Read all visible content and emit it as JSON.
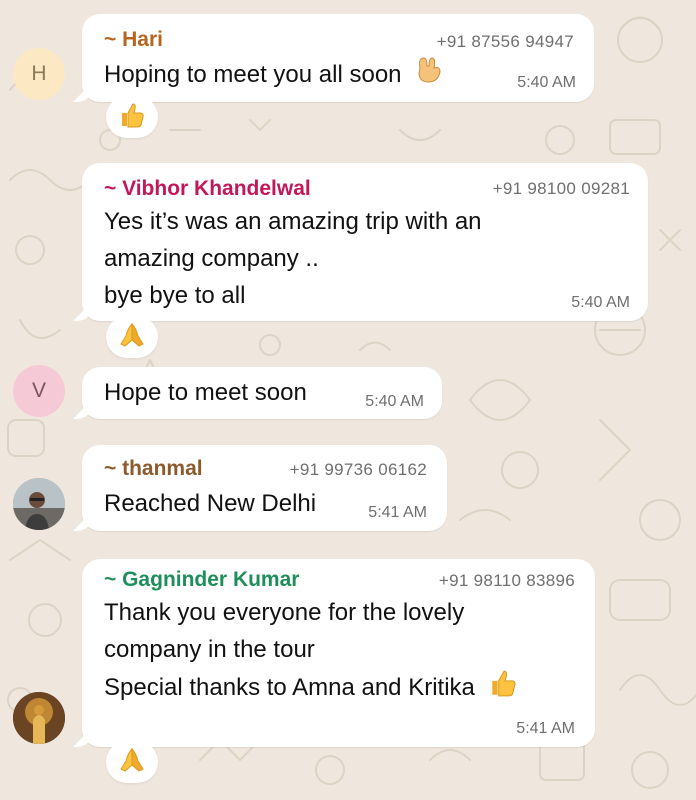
{
  "messages": [
    {
      "avatar_letter": "H",
      "sender": "~ Hari",
      "phone": "+91 87556 94947",
      "lines": [
        "Hoping to meet you all soon"
      ],
      "inline_emoji": "rock-hand-emoji",
      "time": "5:40 AM",
      "reaction": "thumbs-up-emoji",
      "sender_color": "#b5651d"
    },
    {
      "sender": "~ Vibhor Khandelwal",
      "phone": "+91 98100 09281",
      "lines": [
        "Yes it’s was an amazing trip with an",
        "amazing company ..",
        "bye bye to all"
      ],
      "time": "5:40 AM",
      "reaction": "folded-hands-emoji",
      "sender_color": "#c2185b"
    },
    {
      "avatar_letter": "V",
      "lines": [
        "Hope to meet soon"
      ],
      "time": "5:40 AM"
    },
    {
      "sender": "~ thanmal",
      "phone": "+91 99736 06162",
      "lines": [
        "Reached New Delhi"
      ],
      "time": "5:41 AM",
      "sender_color": "#8d5a2b"
    },
    {
      "sender": "~ Gagninder Kumar",
      "phone": "+91 98110 83896",
      "lines": [
        "Thank you everyone for the lovely",
        "company in the tour",
        "Special thanks to Amna and Kritika"
      ],
      "inline_emoji": "thumbs-up-emoji",
      "time": "5:41 AM",
      "reaction": "folded-hands-emoji",
      "sender_color": "#1e8e5a"
    }
  ],
  "colors": {
    "background": "#efe7dd",
    "bubble": "#ffffff",
    "avatar_h_bg": "#fde8c4",
    "avatar_v_bg": "#f6c9d6",
    "meta_text": "#6f6f6f"
  }
}
